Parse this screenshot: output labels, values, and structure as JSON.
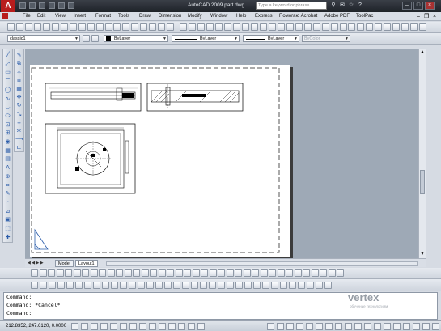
{
  "app": {
    "logo_letter": "A",
    "title": "AutoCAD 2009  part.dwg",
    "search_placeholder": "Type a keyword or phrase"
  },
  "menu": [
    {
      "label": "File",
      "name": "menu-file"
    },
    {
      "label": "Edit",
      "name": "menu-edit"
    },
    {
      "label": "View",
      "name": "menu-view"
    },
    {
      "label": "Insert",
      "name": "menu-insert"
    },
    {
      "label": "Format",
      "name": "menu-format"
    },
    {
      "label": "Tools",
      "name": "menu-tools"
    },
    {
      "label": "Draw",
      "name": "menu-draw"
    },
    {
      "label": "Dimension",
      "name": "menu-dimension"
    },
    {
      "label": "Modify",
      "name": "menu-modify"
    },
    {
      "label": "Window",
      "name": "menu-window"
    },
    {
      "label": "Help",
      "name": "menu-help"
    },
    {
      "label": "Express",
      "name": "menu-express"
    },
    {
      "label": "Помогаю Acrobat",
      "name": "menu-acrobat-ru"
    },
    {
      "label": "Adobe PDF",
      "name": "menu-adobe-pdf"
    },
    {
      "label": "ToolPac",
      "name": "menu-toolpac"
    }
  ],
  "properties": {
    "workspace": "classic1",
    "color": "ByLayer",
    "linetype": "ByLayer",
    "lineweight": "ByLayer",
    "plotstyle": "ByColor"
  },
  "layout_tabs": [
    "Model",
    "Layout1"
  ],
  "command_lines": [
    "Command:",
    "Command: *Cancel*",
    "Command:"
  ],
  "status": {
    "coordinates": "212.8352, 247.6120, 0.0000"
  },
  "watermark": {
    "brand": "vertex",
    "sub": "обучение технологиям"
  },
  "colors": {
    "accent_red": "#b81d1d",
    "titlebar": "#2a2e35",
    "canvas": "#9ea9b6",
    "paper": "#ffffff"
  }
}
